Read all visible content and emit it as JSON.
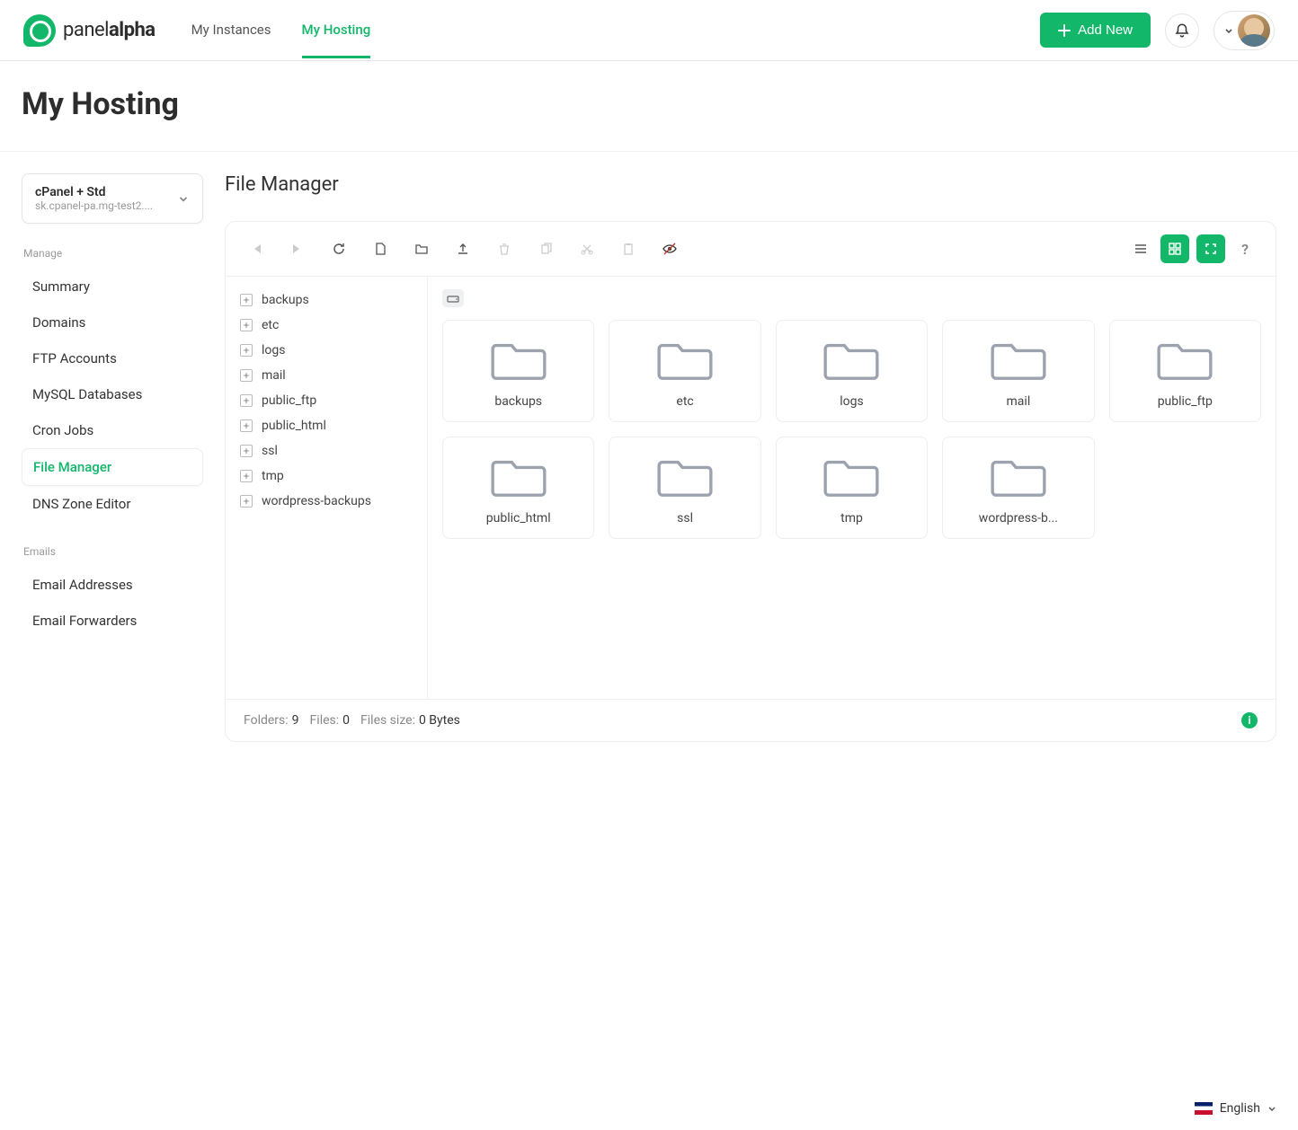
{
  "brand": {
    "name_prefix": "panel",
    "name_suffix": "alpha"
  },
  "top_nav": [
    {
      "label": "My Instances",
      "active": false
    },
    {
      "label": "My Hosting",
      "active": true
    }
  ],
  "add_new_label": "Add New",
  "page_title": "My Hosting",
  "account_selector": {
    "title": "cPanel + Std",
    "subtitle": "sk.cpanel-pa.mg-test2...."
  },
  "side_sections": {
    "manage": {
      "label": "Manage",
      "items": [
        {
          "label": "Summary"
        },
        {
          "label": "Domains"
        },
        {
          "label": "FTP Accounts"
        },
        {
          "label": "MySQL Databases"
        },
        {
          "label": "Cron Jobs"
        },
        {
          "label": "File Manager",
          "active": true
        },
        {
          "label": "DNS Zone Editor"
        }
      ]
    },
    "emails": {
      "label": "Emails",
      "items": [
        {
          "label": "Email Addresses"
        },
        {
          "label": "Email Forwarders"
        }
      ]
    }
  },
  "panel_title": "File Manager",
  "tree_items": [
    "backups",
    "etc",
    "logs",
    "mail",
    "public_ftp",
    "public_html",
    "ssl",
    "tmp",
    "wordpress-backups"
  ],
  "folders": [
    "backups",
    "etc",
    "logs",
    "mail",
    "public_ftp",
    "public_html",
    "ssl",
    "tmp",
    "wordpress-b..."
  ],
  "status": {
    "folders_label": "Folders:",
    "folders_val": "9",
    "files_label": "Files:",
    "files_val": "0",
    "filesize_label": "Files size:",
    "filesize_val": "0 Bytes"
  },
  "footer": {
    "language": "English"
  }
}
